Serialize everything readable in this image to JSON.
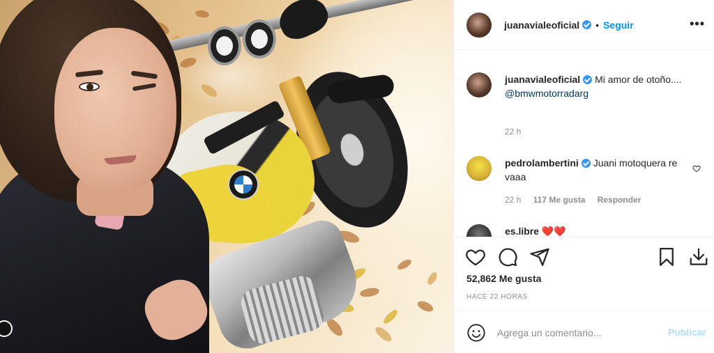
{
  "post": {
    "username": "juanavialeoficial",
    "separator": "•",
    "follow_label": "Seguir",
    "more_label": "•••"
  },
  "comments": [
    {
      "username": "juanavialeoficial",
      "text": "Mi amor de otoño....",
      "mention": "@bmwmotorradarg",
      "time": "22 h"
    },
    {
      "username": "pedrolambertini",
      "text": "Juani motoquera re vaaa",
      "time": "22 h",
      "likes": "117 Me gusta",
      "reply_label": "Responder"
    },
    {
      "username": "es.libre",
      "text": "❤️❤️"
    }
  ],
  "actions": {
    "icons": [
      "heart-icon",
      "comment-icon",
      "share-icon",
      "bookmark-icon",
      "download-icon"
    ],
    "likes_count": "52,862 Me gusta",
    "time_ago": "HACE 22 HORAS"
  },
  "add_comment": {
    "placeholder": "Agrega un comentario...",
    "publish_label": "Publicar"
  },
  "colors": {
    "link_blue": "#0095f6",
    "verified_blue": "#3897f0",
    "publish_disabled": "#b2dffc",
    "muted_gray": "#8e8e8e"
  }
}
